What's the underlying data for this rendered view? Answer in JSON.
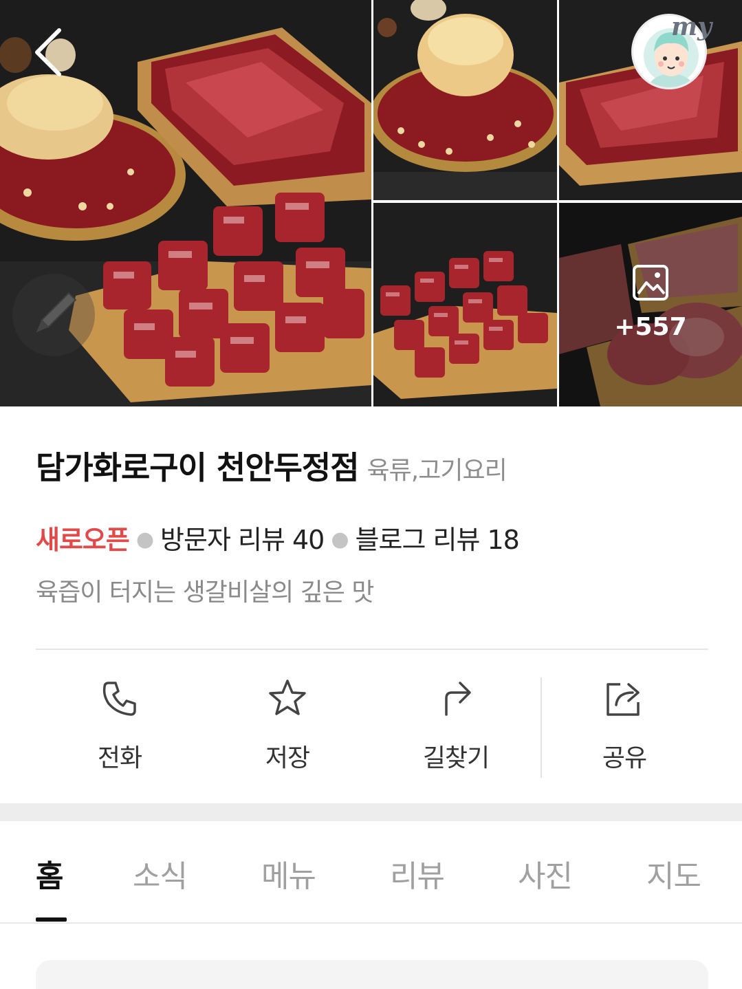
{
  "gallery": {
    "photos": [
      "meat-platter-main",
      "garlic-beef-bowl",
      "sliced-beef-board",
      "cubed-beef-board",
      "pork-cuts-board"
    ],
    "more_count": "+557",
    "icons": {
      "back": "chevron-left-icon",
      "edit": "pencil-icon",
      "more": "image-icon"
    },
    "my_badge": "my"
  },
  "place": {
    "name": "담가화로구이 천안두정점",
    "category": "육류,고기요리",
    "status": "새로오픈",
    "visitor_reviews": "방문자 리뷰 40",
    "blog_reviews": "블로그 리뷰 18",
    "description": "육즙이 터지는 생갈비살의 깊은 맛"
  },
  "actions": [
    {
      "label": "전화",
      "icon": "phone-icon"
    },
    {
      "label": "저장",
      "icon": "star-icon"
    },
    {
      "label": "길찾기",
      "icon": "directions-icon"
    },
    {
      "label": "공유",
      "icon": "share-icon"
    }
  ],
  "tabs": [
    {
      "label": "홈",
      "active": true
    },
    {
      "label": "소식"
    },
    {
      "label": "메뉴"
    },
    {
      "label": "리뷰"
    },
    {
      "label": "사진"
    },
    {
      "label": "지도"
    }
  ],
  "colors": {
    "status_red": "#e24a4a",
    "text_dark": "#111111",
    "text_gray": "#8a8a8a",
    "tab_inactive": "#a0a0a0",
    "band": "#ededee"
  }
}
